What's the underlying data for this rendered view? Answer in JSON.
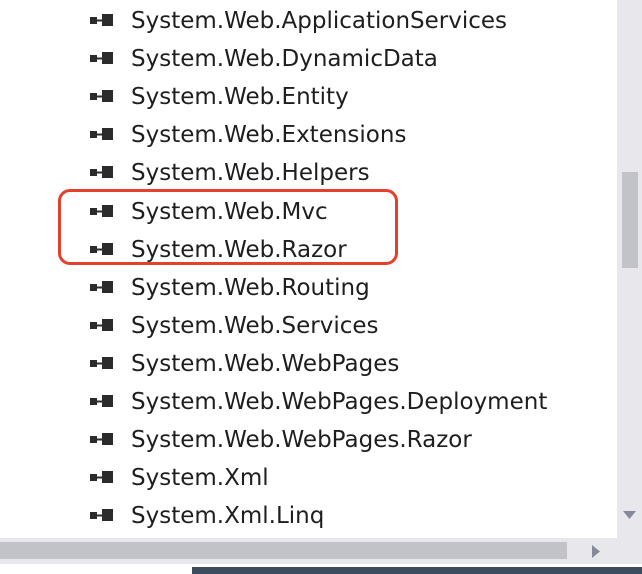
{
  "references": [
    {
      "label": "System.Web.ApplicationServices",
      "icon": "assembly-reference-icon"
    },
    {
      "label": "System.Web.DynamicData",
      "icon": "assembly-reference-icon"
    },
    {
      "label": "System.Web.Entity",
      "icon": "assembly-reference-icon"
    },
    {
      "label": "System.Web.Extensions",
      "icon": "assembly-reference-icon"
    },
    {
      "label": "System.Web.Helpers",
      "icon": "assembly-reference-icon"
    },
    {
      "label": "System.Web.Mvc",
      "icon": "assembly-reference-icon"
    },
    {
      "label": "System.Web.Razor",
      "icon": "assembly-reference-icon"
    },
    {
      "label": "System.Web.Routing",
      "icon": "assembly-reference-icon"
    },
    {
      "label": "System.Web.Services",
      "icon": "assembly-reference-icon"
    },
    {
      "label": "System.Web.WebPages",
      "icon": "assembly-reference-icon"
    },
    {
      "label": "System.Web.WebPages.Deployment",
      "icon": "assembly-reference-icon"
    },
    {
      "label": "System.Web.WebPages.Razor",
      "icon": "assembly-reference-icon"
    },
    {
      "label": "System.Xml",
      "icon": "assembly-reference-icon"
    },
    {
      "label": "System.Xml.Linq",
      "icon": "assembly-reference-icon"
    }
  ],
  "highlighted_items": [
    "System.Web.Mvc",
    "System.Web.Razor"
  ],
  "colors": {
    "highlight_border": "#e3412b",
    "text": "#1e1e1e",
    "icon": "#2b2b2b",
    "scrollbar_track": "#e8e8ec",
    "scrollbar_thumb": "#c2c3c9"
  }
}
